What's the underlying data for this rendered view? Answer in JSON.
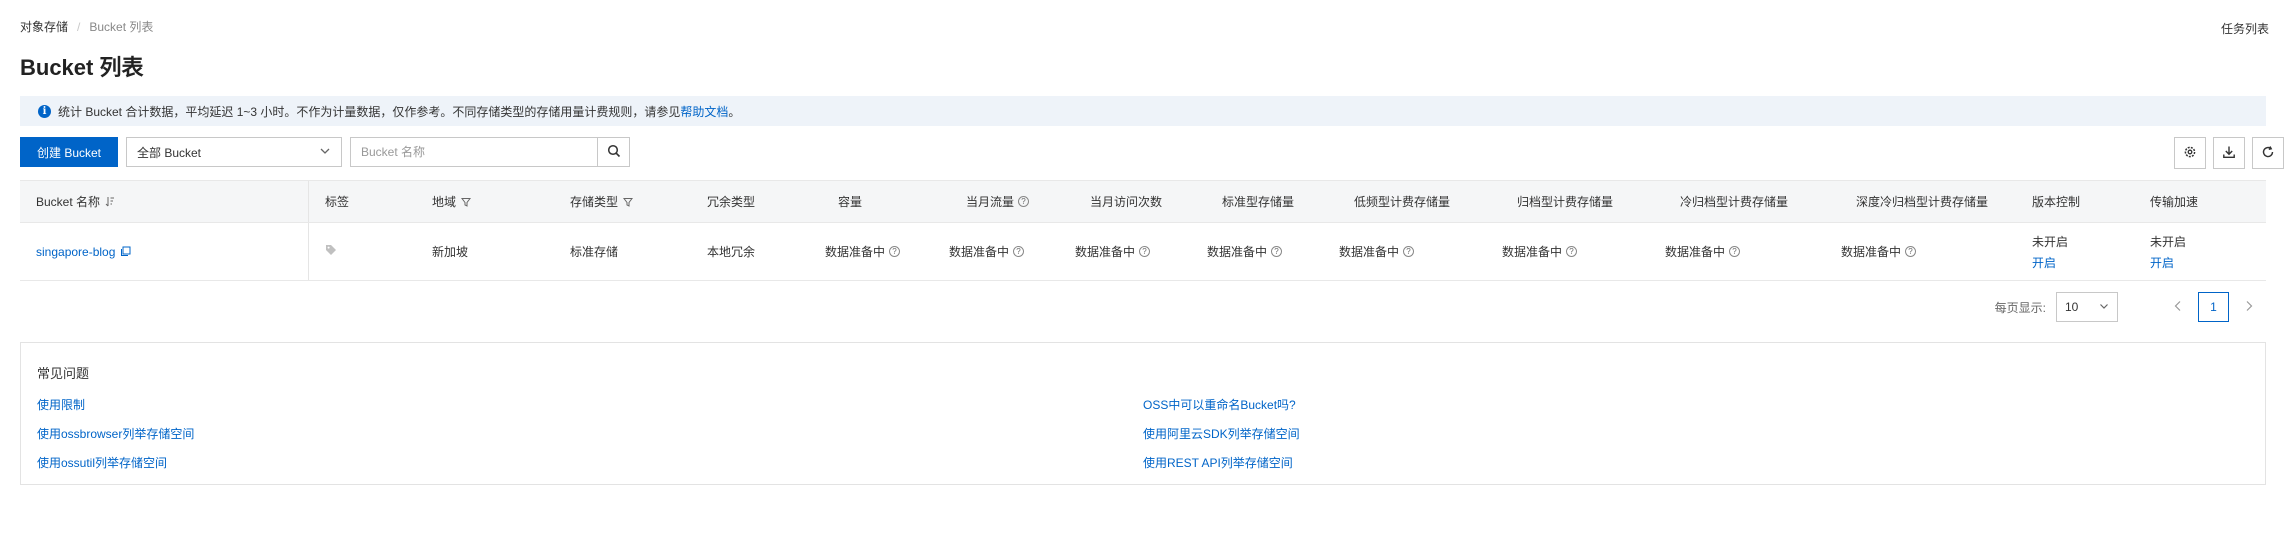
{
  "breadcrumb": {
    "root": "对象存储",
    "separator": "/",
    "current": "Bucket 列表"
  },
  "header": {
    "task_list": "任务列表"
  },
  "page": {
    "title": "Bucket 列表"
  },
  "notice": {
    "text": "统计 Bucket 合计数据，平均延迟 1~3 小时。不作为计量数据，仅作参考。不同存储类型的存储用量计费规则，请参见",
    "link": "帮助文档",
    "suffix": "。",
    "icon": "info-icon"
  },
  "toolbar": {
    "create_label": "创建 Bucket",
    "filter_selected": "全部 Bucket",
    "search_placeholder": "Bucket 名称",
    "icons": [
      "settings-icon",
      "download-icon",
      "refresh-icon"
    ]
  },
  "table": {
    "columns": [
      {
        "label": "Bucket 名称"
      },
      {
        "label": "标签"
      },
      {
        "label": "地域"
      },
      {
        "label": "存储类型"
      },
      {
        "label": "冗余类型"
      },
      {
        "label": "容量"
      },
      {
        "label": "当月流量"
      },
      {
        "label": "当月访问次数"
      },
      {
        "label": "标准型存储量"
      },
      {
        "label": "低频型计费存储量"
      },
      {
        "label": "归档型计费存储量"
      },
      {
        "label": "冷归档型计费存储量"
      },
      {
        "label": "深度冷归档型计费存储量"
      },
      {
        "label": "版本控制"
      },
      {
        "label": "传输加速"
      }
    ],
    "rows": [
      {
        "name": "singapore-blog",
        "region": "新加坡",
        "storage_type": "标准存储",
        "redundancy": "本地冗余",
        "capacity": "数据准备中",
        "monthly_traffic": "数据准备中",
        "monthly_requests": "数据准备中",
        "standard_storage": "数据准备中",
        "ia_storage": "数据准备中",
        "archive_storage": "数据准备中",
        "cold_archive_storage": "数据准备中",
        "deep_cold_archive_storage": "数据准备中",
        "versioning_status": "未开启",
        "versioning_action": "开启",
        "acceleration_status": "未开启",
        "acceleration_action": "开启"
      }
    ]
  },
  "pagination": {
    "page_size_label": "每页显示:",
    "page_size": "10",
    "current_page": "1"
  },
  "faq": {
    "title": "常见问题",
    "left": [
      "使用限制",
      "使用ossbrowser列举存储空间",
      "使用ossutil列举存储空间"
    ],
    "right": [
      "OSS中可以重命名Bucket吗?",
      "使用阿里云SDK列举存储空间",
      "使用REST API列举存储空间"
    ]
  },
  "colors": {
    "accent": "#0064c8",
    "notice_bg": "#eef3f9",
    "header_bg": "#f5f6f7"
  }
}
